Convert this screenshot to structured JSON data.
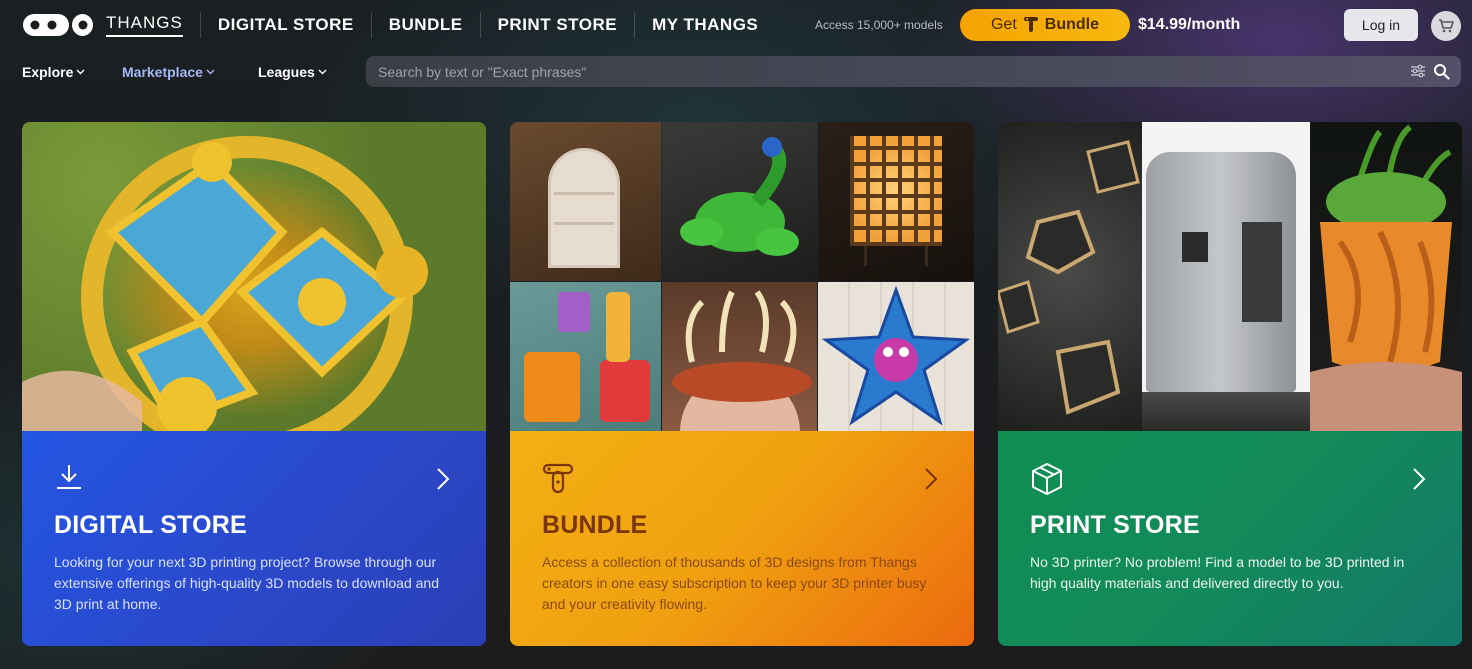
{
  "header": {
    "nav": [
      "THANGS",
      "DIGITAL STORE",
      "BUNDLE",
      "PRINT STORE",
      "MY THANGS"
    ],
    "access_text": "Access 15,000+ models",
    "bundle_button": {
      "prefix": "Get",
      "label": "Bundle"
    },
    "price": "$14.99/month",
    "login": "Log in"
  },
  "subnav": {
    "items": [
      "Explore",
      "Marketplace",
      "Leagues"
    ],
    "active": "Marketplace"
  },
  "search": {
    "placeholder": "Search by text or \"Exact phrases\""
  },
  "cards": [
    {
      "title": "DIGITAL STORE",
      "description": "Looking for your next 3D printing project? Browse through our extensive offerings of high-quality 3D models to download and 3D print at home.",
      "icon": "download-icon",
      "accent": "#2456e3"
    },
    {
      "title": "BUNDLE",
      "description": "Access a collection of thousands of 3D designs from Thangs creators in one easy subscription to keep your 3D printer busy and your creativity flowing.",
      "icon": "bundle-icon",
      "accent": "#f3b014"
    },
    {
      "title": "PRINT STORE",
      "description": "No 3D printer? No problem! Find a model to be 3D printed in high quality materials and delivered directly to you.",
      "icon": "box-icon",
      "accent": "#0f8f52"
    }
  ],
  "colors": {
    "bundle_button": "#f5a300",
    "active_subnav": "#a4b6f5"
  }
}
